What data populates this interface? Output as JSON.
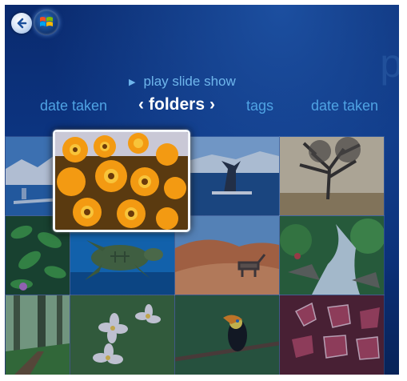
{
  "nav": {
    "back_icon": "back-arrow-icon",
    "orb_icon": "windows-logo-icon"
  },
  "header": {
    "ghost_letter": "p"
  },
  "actions": {
    "play_label": "play slide show",
    "play_icon": "play-triangle-icon"
  },
  "tabs": [
    {
      "label": "date taken",
      "current": false
    },
    {
      "label": "folders",
      "current": true
    },
    {
      "label": "tags",
      "current": false
    },
    {
      "label": "date taken",
      "current": false
    }
  ],
  "tabs_chevrons": {
    "left": "‹",
    "right": "›"
  },
  "gallery": {
    "selected_index": 1,
    "tiles": [
      "pier-photo",
      "flowers-photo",
      "whale-photo",
      "tree-photo",
      "leaves-photo",
      "turtle-photo",
      "desert-photo",
      "waterfall-photo",
      "forest-photo",
      "frangipani-photo",
      "toucan-photo",
      "red-leaves-photo"
    ]
  }
}
